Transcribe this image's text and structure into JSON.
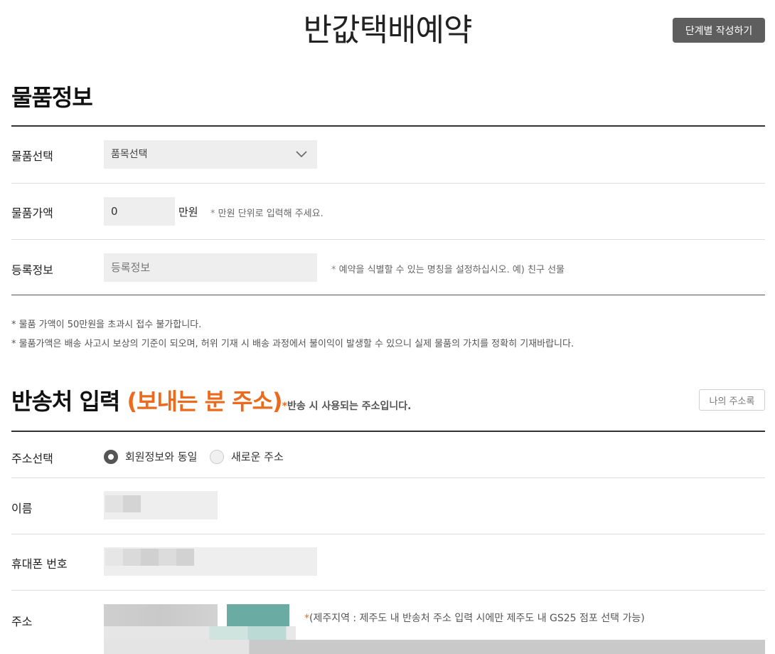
{
  "header": {
    "title": "반값택배예약",
    "step_button_label": "단계별 작성하기"
  },
  "item_section": {
    "title": "물품정보",
    "rows": {
      "item_select": {
        "label": "물품선택",
        "value": "품목선택"
      },
      "item_value": {
        "label": "물품가액",
        "value": "0",
        "unit": "만원",
        "hint_mark": "*",
        "hint": "만원 단위로 입력해 주세요."
      },
      "registration": {
        "label": "등록정보",
        "placeholder": "등록정보",
        "hint_mark": "*",
        "hint": "예약을 식별할 수 있는 명칭을 설정하십시오. 예) 친구 선물"
      }
    },
    "notes": [
      "* 물품 가액이 50만원을 초과시 접수 불가합니다.",
      "* 물품가액은 배송 사고시 보상의 기준이 되오며, 허위 기재 시 배송 과정에서 불이익이 발생할 수 있으니 실제 물품의 가치를 정확히 기재바랍니다."
    ]
  },
  "sender_section": {
    "title": "반송처 입력",
    "title_highlight": "(보내는 분 주소)",
    "hint_mark": "*",
    "hint": "반송 시 사용되는 주소입니다.",
    "address_book_button": "나의 주소록",
    "rows": {
      "address_select": {
        "label": "주소선택",
        "options": [
          {
            "label": "회원정보와 동일",
            "checked": true
          },
          {
            "label": "새로운 주소",
            "checked": false
          }
        ]
      },
      "name": {
        "label": "이름"
      },
      "phone": {
        "label": "휴대폰 번호"
      },
      "address": {
        "label": "주소",
        "hint_mark": "*",
        "hint": "(제주지역 : 제주도 내 반송처 주소 입력 시에만 제주도 내 GS25 점포 선택 가능)"
      }
    }
  },
  "colors": {
    "accent_orange": "#ec6a1c",
    "button_dark": "#5e5e5e",
    "input_bg": "#eeeeee",
    "zip_button": "#6aaba3"
  }
}
